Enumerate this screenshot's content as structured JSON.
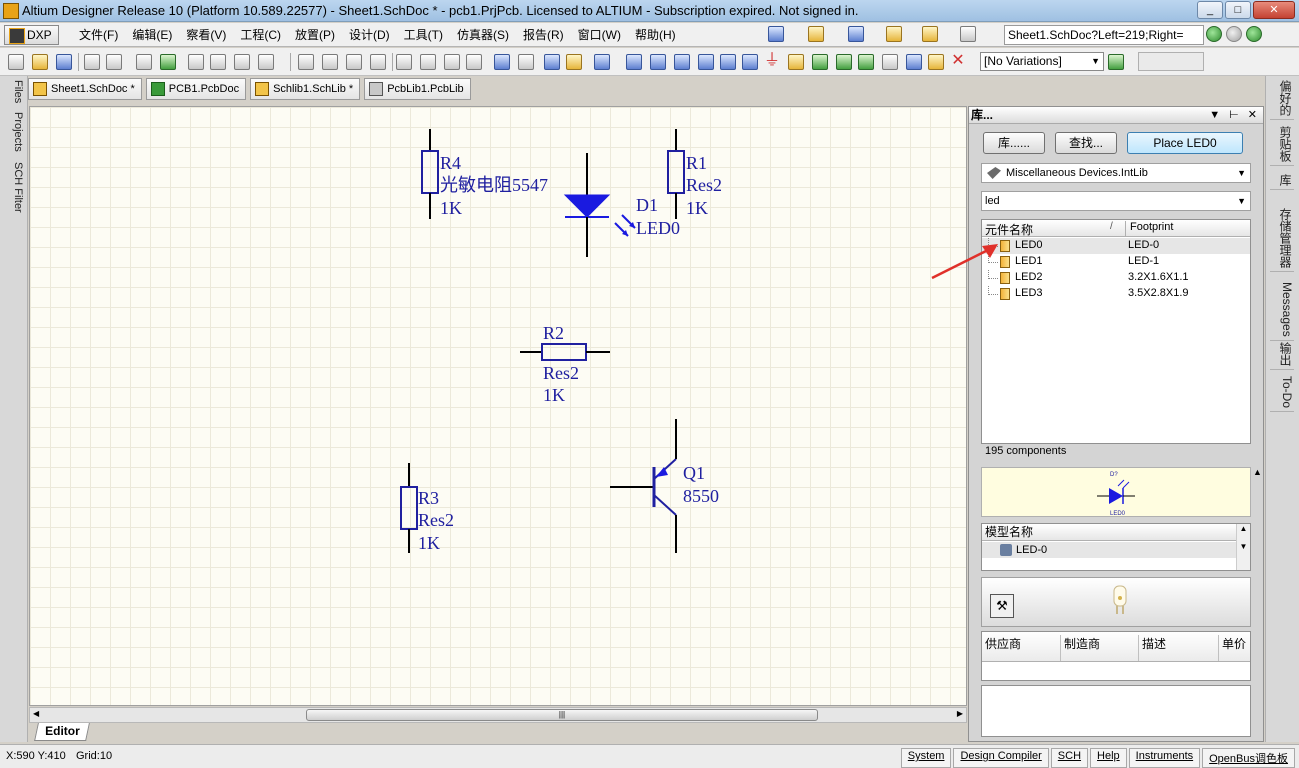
{
  "window": {
    "title": "Altium Designer Release 10 (Platform 10.589.22577) - Sheet1.SchDoc * - pcb1.PrjPcb. Licensed to ALTIUM - Subscription expired. Not signed in.",
    "min": "_",
    "max": "□",
    "close": "✕"
  },
  "menubar": {
    "dxp": "DXP",
    "items": [
      "文件(F)",
      "编辑(E)",
      "察看(V)",
      "工程(C)",
      "放置(P)",
      "设计(D)",
      "工具(T)",
      "仿真器(S)",
      "报告(R)",
      "窗口(W)",
      "帮助(H)"
    ],
    "doc_path": "Sheet1.SchDoc?Left=219;Right="
  },
  "toolbar": {
    "variations": "[No Variations]"
  },
  "doc_tabs": [
    "Sheet1.SchDoc *",
    "PCB1.PcbDoc",
    "Schlib1.SchLib *",
    "PcbLib1.PcbLib"
  ],
  "left_tabs": [
    "Files",
    "Projects",
    "SCH Filter"
  ],
  "schematic": {
    "components": [
      {
        "designator": "R4",
        "comment": "光敏电阻5547",
        "value": "1K"
      },
      {
        "designator": "R1",
        "comment": "Res2",
        "value": "1K"
      },
      {
        "designator": "D1",
        "comment": "LED0"
      },
      {
        "designator": "R2",
        "comment": "Res2",
        "value": "1K"
      },
      {
        "designator": "R3",
        "comment": "Res2",
        "value": "1K"
      },
      {
        "designator": "Q1",
        "comment": "8550"
      }
    ]
  },
  "editor_tab": "Editor",
  "status": {
    "coords": "X:590 Y:410",
    "grid": "Grid:10",
    "tabs": [
      "System",
      "Design Compiler",
      "SCH",
      "Help",
      "Instruments",
      "OpenBus调色板"
    ]
  },
  "library_panel": {
    "title": "库...",
    "btn_libraries": "库......",
    "btn_search": "查找...",
    "btn_place": "Place LED0",
    "library_name": "Miscellaneous Devices.IntLib",
    "filter": "led",
    "col_name": "元件名称",
    "col_sort": "/",
    "col_footprint": "Footprint",
    "components": [
      {
        "name": "LED0",
        "footprint": "LED-0"
      },
      {
        "name": "LED1",
        "footprint": "LED-1"
      },
      {
        "name": "LED2",
        "footprint": "3.2X1.6X1.1"
      },
      {
        "name": "LED3",
        "footprint": "3.5X2.8X1.9"
      }
    ],
    "count": "195 components",
    "preview_designator": "D?",
    "preview_name": "LED0",
    "model_header": "模型名称",
    "model_row": "LED-0",
    "supplier_cols": [
      "供应商",
      "制造商",
      "描述",
      "单价"
    ]
  },
  "right_tabs": [
    "偏好的",
    "剪贴板",
    "库",
    "存储管理器",
    "Messages",
    "输出",
    "To-Do"
  ]
}
